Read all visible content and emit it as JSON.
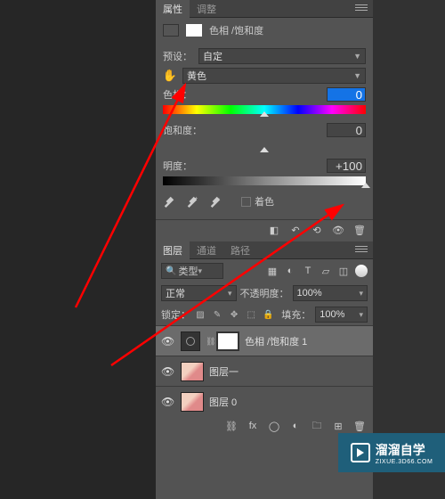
{
  "properties_panel": {
    "tabs": {
      "properties": "属性",
      "adjust": "调整"
    },
    "title": "色相 /饱和度",
    "preset_label": "预设：",
    "preset_value": "自定",
    "range_value": "黄色",
    "hue": {
      "label": "色相：",
      "value": "0"
    },
    "saturation": {
      "label": "饱和度：",
      "value": "0"
    },
    "lightness": {
      "label": "明度：",
      "value": "+100"
    },
    "colorize_label": "着色"
  },
  "layers_panel": {
    "tabs": {
      "layers": "图层",
      "channels": "通道",
      "paths": "路径"
    },
    "kind_label": "类型",
    "blend_mode": "正常",
    "opacity_label": "不透明度：",
    "opacity_value": "100%",
    "lock_label": "锁定：",
    "fill_label": "填充：",
    "fill_value": "100%",
    "layers": [
      {
        "name": "色相 /饱和度 1"
      },
      {
        "name": "图层一"
      },
      {
        "name": "图层 0"
      }
    ]
  },
  "watermark": {
    "text": "溜溜自学",
    "url": "ZIXUE.3D66.COM"
  }
}
